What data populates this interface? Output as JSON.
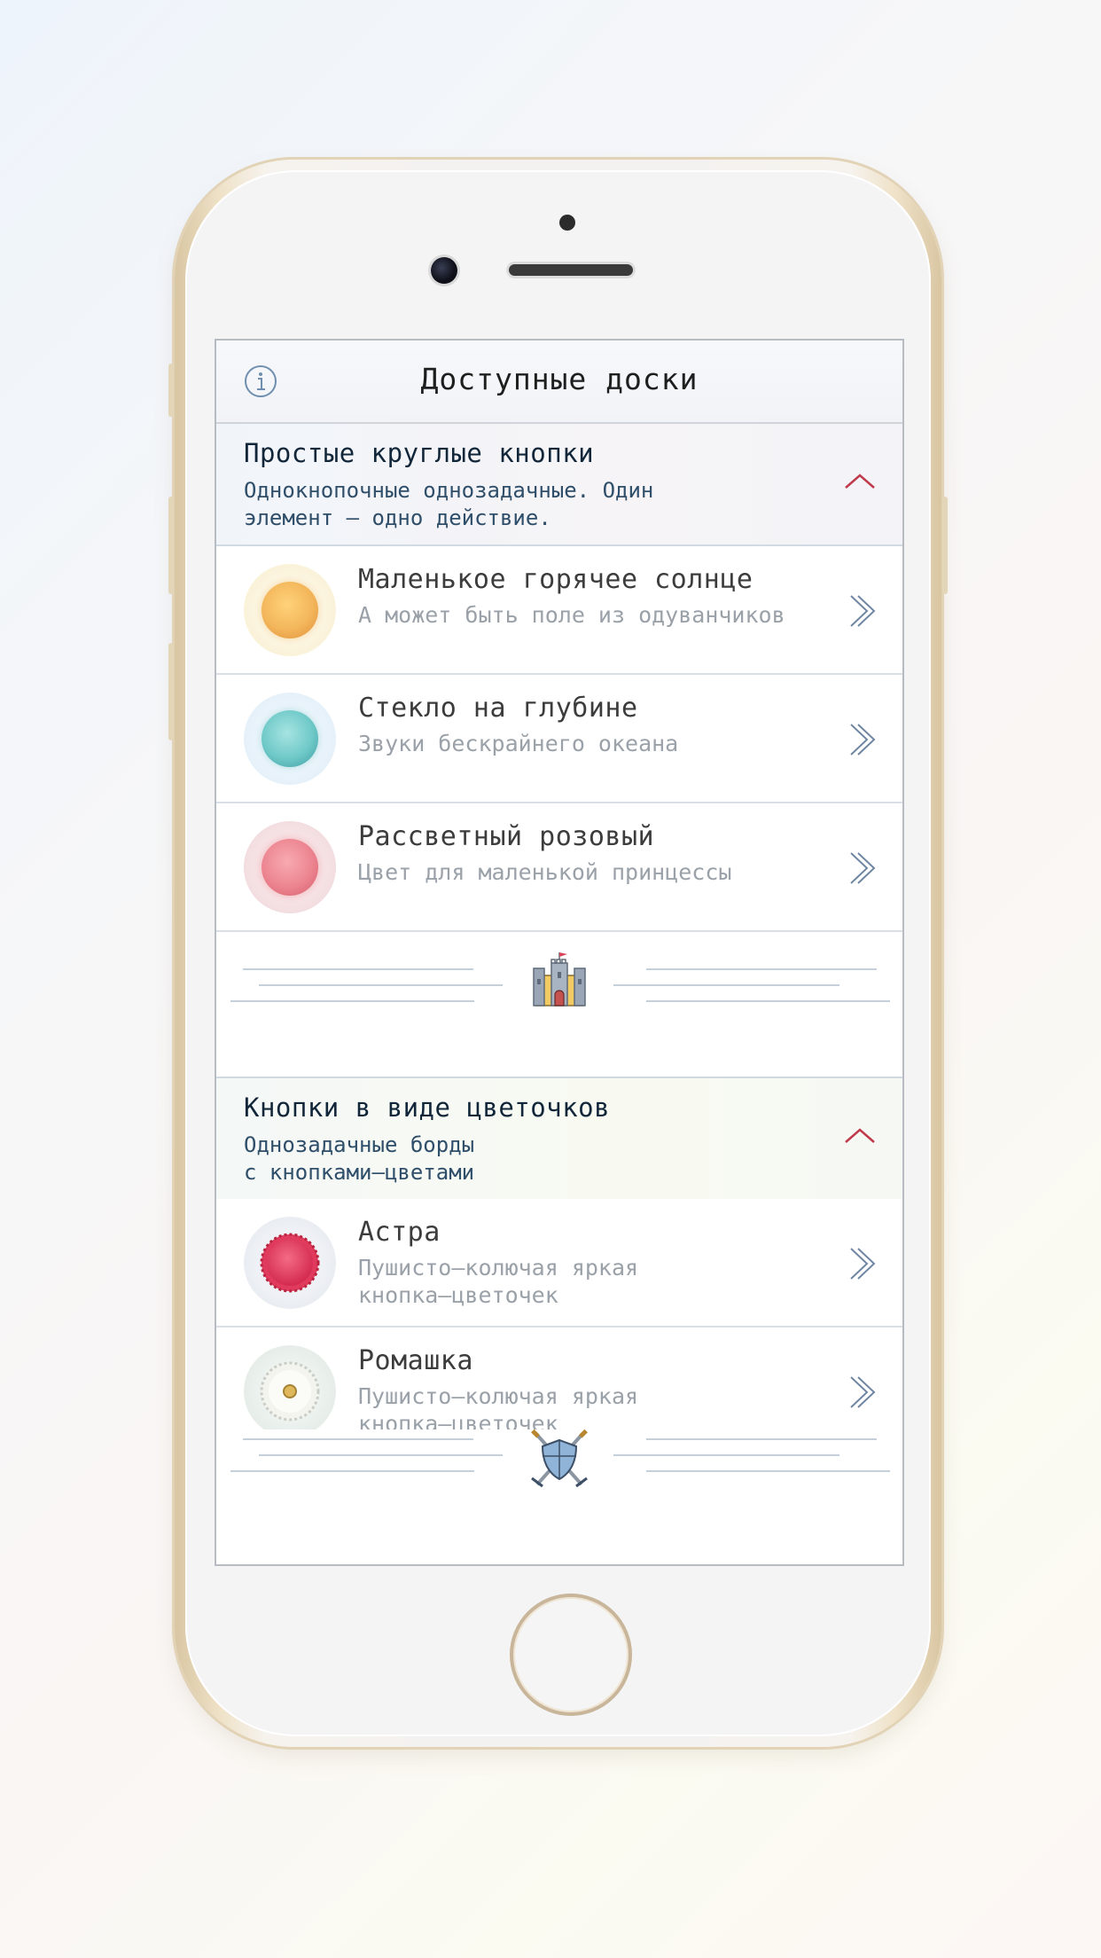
{
  "nav": {
    "title": "Доступные доски",
    "info_icon": "info-icon"
  },
  "sections": [
    {
      "title": "Простые круглые кнопки",
      "subtitle": "Однокнопочные однозадачные. Один\nэлемент – одно действие.",
      "collapse_icon": "chevron-up-icon",
      "items": [
        {
          "title": "Маленькое горячее солнце",
          "subtitle": "А может быть поле из одуванчиков",
          "color": "#f3b65a",
          "halo": "#fbf2d9"
        },
        {
          "title": "Стекло на глубине",
          "subtitle": "Звуки бескрайнего океана",
          "color": "#6fc9c8",
          "halo": "#e6f2fa"
        },
        {
          "title": "Рассветный розовый",
          "subtitle": "Цвет для маленькой принцессы",
          "color": "#ec8590",
          "halo": "#f6e3e5"
        }
      ]
    },
    {
      "title": "Кнопки в виде цветочков",
      "subtitle": "Однозадачные борды\nс кнопками–цветами",
      "collapse_icon": "chevron-up-icon",
      "items": [
        {
          "title": "Астра",
          "subtitle": "Пушисто–колючая яркая\nкнопка–цветочек",
          "color": "#e03a5c",
          "halo": "#e9edf3"
        },
        {
          "title": "Ромашка",
          "subtitle": "Пушисто–колючая яркая\nкнопка–цветочек",
          "color": "#f4f4ef",
          "halo": "#e6ede9"
        }
      ]
    }
  ],
  "dividers": [
    {
      "icon": "castle-icon"
    },
    {
      "icon": "shield-swords-icon"
    }
  ],
  "colors": {
    "accent": "#c0394b",
    "chevron": "#6f87a3",
    "text_primary": "#12263a"
  }
}
